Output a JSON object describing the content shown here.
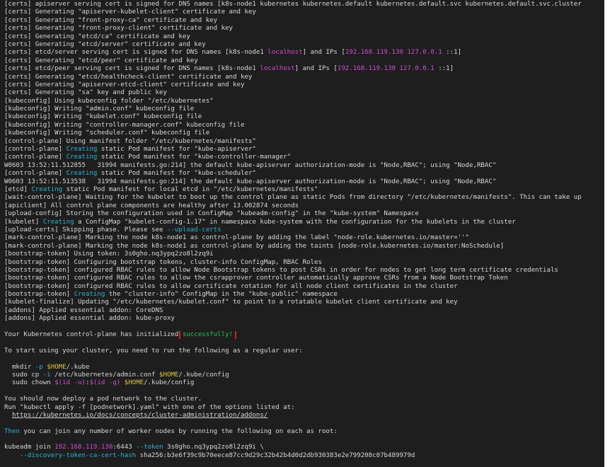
{
  "terminal": {
    "lines": [
      [
        {
          "t": "[certs] apiserver serving cert is signed for DNS names [k8s-node1 kubernetes kubernetes.default kubernetes.default.svc kubernetes.default.svc.cluster"
        }
      ],
      [
        {
          "t": "[certs] Generating \"apiserver-kubelet-client\" certificate and key"
        }
      ],
      [
        {
          "t": "[certs] Generating \"front-proxy-ca\" certificate and key"
        }
      ],
      [
        {
          "t": "[certs] Generating \"front-proxy-client\" certificate and key"
        }
      ],
      [
        {
          "t": "[certs] Generating \"etcd/ca\" certificate and key"
        }
      ],
      [
        {
          "t": "[certs] Generating \"etcd/server\" certificate and key"
        }
      ],
      [
        {
          "t": "[certs] etcd/server serving cert is signed for DNS names [k8s-node1 "
        },
        {
          "t": "localhost",
          "c": "magenta"
        },
        {
          "t": "] and IPs ["
        },
        {
          "t": "192.168.119.130 127.0.0.1",
          "c": "magenta"
        },
        {
          "t": " ::1]"
        }
      ],
      [
        {
          "t": "[certs] Generating \"etcd/peer\" certificate and key"
        }
      ],
      [
        {
          "t": "[certs] etcd/peer serving cert is signed for DNS names [k8s-node1 "
        },
        {
          "t": "localhost",
          "c": "magenta"
        },
        {
          "t": "] and IPs ["
        },
        {
          "t": "192.168.119.130 127.0.0.1",
          "c": "magenta"
        },
        {
          "t": " ::1]"
        }
      ],
      [
        {
          "t": "[certs] Generating \"etcd/healthcheck-client\" certificate and key"
        }
      ],
      [
        {
          "t": "[certs] Generating \"apiserver-etcd-client\" certificate and key"
        }
      ],
      [
        {
          "t": "[certs] Generating \"sa\" key and public key"
        }
      ],
      [
        {
          "t": "[kubeconfig] Using kubeconfig folder \"/etc/kubernetes\""
        }
      ],
      [
        {
          "t": "[kubeconfig] Writing \"admin.conf\" kubeconfig file"
        }
      ],
      [
        {
          "t": "[kubeconfig] Writing \"kubelet.conf\" kubeconfig file"
        }
      ],
      [
        {
          "t": "[kubeconfig] Writing \"controller-manager.conf\" kubeconfig file"
        }
      ],
      [
        {
          "t": "[kubeconfig] Writing \"scheduler.conf\" kubeconfig file"
        }
      ],
      [
        {
          "t": "[control-plane] Using manifest folder \"/etc/kubernetes/manifests\""
        }
      ],
      [
        {
          "t": "[control-plane] "
        },
        {
          "t": "Creating",
          "c": "cyan"
        },
        {
          "t": " static Pod manifest for \"kube-apiserver\""
        }
      ],
      [
        {
          "t": "[control-plane] "
        },
        {
          "t": "Creating",
          "c": "cyan"
        },
        {
          "t": " static Pod manifest for \"kube-controller-manager\""
        }
      ],
      [
        {
          "t": "W0603 13:52:11.512855   31994 manifests.go:214] the default kube-apiserver authorization-mode is \"Node,RBAC\"; using \"Node,RBAC\""
        }
      ],
      [
        {
          "t": "[control-plane] "
        },
        {
          "t": "Creating",
          "c": "cyan"
        },
        {
          "t": " static Pod manifest for \"kube-scheduler\""
        }
      ],
      [
        {
          "t": "W0603 13:52:11.513538   31994 manifests.go:214] the default kube-apiserver authorization-mode is \"Node,RBAC\"; using \"Node,RBAC\""
        }
      ],
      [
        {
          "t": "[etcd] "
        },
        {
          "t": "Creating",
          "c": "cyan"
        },
        {
          "t": " static Pod manifest for local etcd in \"/etc/kubernetes/manifests\""
        }
      ],
      [
        {
          "t": "[wait-control-plane] Waiting for the kubelet to boot up the control plane as static Pods from directory \"/etc/kubernetes/manifests\". This can take up"
        }
      ],
      [
        {
          "t": "[apiclient] All control plane components are healthy after 13.002874 seconds"
        }
      ],
      [
        {
          "t": "[upload-config] Storing the configuration used in ConfigMap \"kubeadm-config\" in the \"kube-system\" Namespace"
        }
      ],
      [
        {
          "t": "[kubelet] "
        },
        {
          "t": "Creating",
          "c": "cyan"
        },
        {
          "t": " a ConfigMap \"kubelet-config-1.17\" in namespace kube-system with the configuration for the kubelets in the cluster"
        }
      ],
      [
        {
          "t": "[upload-certs] Skipping phase. Please see "
        },
        {
          "t": "--upload-certs",
          "c": "cyan"
        }
      ],
      [
        {
          "t": "[mark-control-plane] Marking the node k8s-node1 as control-plane by adding the label \"node-role.kubernetes.io/master=''\""
        }
      ],
      [
        {
          "t": "[mark-control-plane] Marking the node k8s-node1 as control-plane by adding the taints [node-role.kubernetes.io/master:NoSchedule]"
        }
      ],
      [
        {
          "t": "[bootstrap-token] Using token: 3s0gho.nq3ypq2zo8l2zq9i"
        }
      ],
      [
        {
          "t": "[bootstrap-token] Configuring bootstrap tokens, cluster-info ConfigMap, RBAC Roles"
        }
      ],
      [
        {
          "t": "[bootstrap-token] configured RBAC rules to allow Node Bootstrap tokens to post CSRs in order for nodes to get long term certificate credentials"
        }
      ],
      [
        {
          "t": "[bootstrap-token] configured RBAC rules to allow the csrapprover controller automatically approve CSRs from a Node Bootstrap Token"
        }
      ],
      [
        {
          "t": "[bootstrap-token] configured RBAC rules to allow certificate rotation for all node client certificates in the cluster"
        }
      ],
      [
        {
          "t": "[bootstrap-token] "
        },
        {
          "t": "Creating",
          "c": "cyan"
        },
        {
          "t": " the \"cluster-info\" ConfigMap in the \"kube-public\" namespace"
        }
      ],
      [
        {
          "t": "[kubelet-finalize] Updating \"/etc/kubernetes/kubelet.conf\" to point to a rotatable kubelet client certificate and key"
        }
      ],
      [
        {
          "t": "[addons] Applied essential addon: CoreDNS"
        }
      ],
      [
        {
          "t": "[addons] Applied essential addon: kube-proxy"
        }
      ],
      [],
      [
        {
          "t": "Your Kubernetes control-plane has initialized "
        },
        {
          "t": "successfully!",
          "c": "green",
          "box": true
        }
      ],
      [],
      [
        {
          "t": "To start using your cluster, you need to run the following as a regular user:"
        }
      ],
      [],
      [
        {
          "t": "  mkdir "
        },
        {
          "t": "-p",
          "c": "cyan"
        },
        {
          "t": " "
        },
        {
          "t": "$HOME",
          "c": "yellow"
        },
        {
          "t": "/.kube"
        }
      ],
      [
        {
          "t": "  sudo cp "
        },
        {
          "t": "-i",
          "c": "cyan"
        },
        {
          "t": " /etc/kubernetes/admin.conf "
        },
        {
          "t": "$HOME",
          "c": "yellow"
        },
        {
          "t": "/.kube/config"
        }
      ],
      [
        {
          "t": "  sudo chown "
        },
        {
          "t": "$(id -u)",
          "c": "magenta"
        },
        {
          "t": ":"
        },
        {
          "t": "$(id -g)",
          "c": "magenta"
        },
        {
          "t": " "
        },
        {
          "t": "$HOME",
          "c": "yellow"
        },
        {
          "t": "/.kube/config"
        }
      ],
      [],
      [
        {
          "t": "You should now deploy a pod network to the cluster."
        }
      ],
      [
        {
          "t": "Run \"kubectl apply -f [podnetwork].yaml\" with one of the options listed at:"
        }
      ],
      [
        {
          "t": "  "
        },
        {
          "t": "https://kubernetes.io/docs/concepts/cluster-administration/addons/",
          "c": "url"
        }
      ],
      [],
      [
        {
          "t": "Then",
          "c": "cyan"
        },
        {
          "t": " you can join any number of worker nodes by running the following on each as root:"
        }
      ],
      [],
      [
        {
          "t": "kubeadm join "
        },
        {
          "t": "192.168.119.130",
          "c": "magenta"
        },
        {
          "t": ":6443 "
        },
        {
          "t": "--token",
          "c": "cyan"
        },
        {
          "t": " 3s0gho.nq3ypq2zo8l2zq9i \\"
        }
      ],
      [
        {
          "t": "    "
        },
        {
          "t": "--discovery-token-ca-cert-hash",
          "c": "cyan"
        },
        {
          "t": " sha256:b3e6f39c9b70eece87cc9d29c32b42b4d0d2db930383e2e799208c07b489979d"
        }
      ]
    ]
  },
  "colors": {
    "background": "#1e1e1e",
    "text": "#d8d8d8",
    "magenta": "#d24ed2",
    "cyan": "#2db3d6",
    "green": "#22c55e",
    "yellow": "#e0c040",
    "highlight_box": "#e11d2a"
  }
}
